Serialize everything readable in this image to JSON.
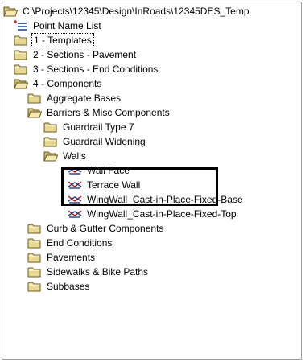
{
  "tree": {
    "root": {
      "label": "C:\\Projects\\12345\\Design\\InRoads\\12345DES_Temp",
      "icon": "open-folder-icon"
    },
    "point_name_list": {
      "label": "Point Name List",
      "icon": "list-icon"
    },
    "templates": {
      "label": "1 - Templates",
      "icon": "folder-icon"
    },
    "sections_pavement": {
      "label": "2 - Sections - Pavement",
      "icon": "folder-icon"
    },
    "sections_end_conditions": {
      "label": "3 - Sections - End Conditions",
      "icon": "folder-icon"
    },
    "components": {
      "label": "4 - Components",
      "icon": "open-folder-icon"
    },
    "aggregate_bases": {
      "label": "Aggregate Bases",
      "icon": "folder-icon"
    },
    "barriers_misc": {
      "label": "Barriers & Misc Components",
      "icon": "open-folder-icon"
    },
    "guardrail_type_7": {
      "label": "Guardrail Type 7",
      "icon": "folder-icon"
    },
    "guardrail_widening": {
      "label": "Guardrail Widening",
      "icon": "folder-icon"
    },
    "walls": {
      "label": "Walls",
      "icon": "open-folder-icon"
    },
    "wall_face": {
      "label": "Wall Face",
      "icon": "template-icon"
    },
    "terrace_wall": {
      "label": "Terrace Wall",
      "icon": "template-icon"
    },
    "wingwall_base": {
      "label": "WingWall_Cast-in-Place-Fixed-Base",
      "icon": "template-icon"
    },
    "wingwall_top": {
      "label": "WingWall_Cast-in-Place-Fixed-Top",
      "icon": "template-icon"
    },
    "curb_gutter": {
      "label": "Curb & Gutter Components",
      "icon": "folder-icon"
    },
    "end_conditions": {
      "label": "End Conditions",
      "icon": "folder-icon"
    },
    "pavements": {
      "label": "Pavements",
      "icon": "folder-icon"
    },
    "sidewalks": {
      "label": "Sidewalks & Bike Paths",
      "icon": "folder-icon"
    },
    "subbases": {
      "label": "Subbases",
      "icon": "folder-icon"
    }
  },
  "colors": {
    "folder_fill": "#e8d890",
    "folder_stroke": "#6b5a1e",
    "template_red": "#cc0000",
    "template_blue": "#1a3d8f",
    "list_red": "#cc0000"
  }
}
